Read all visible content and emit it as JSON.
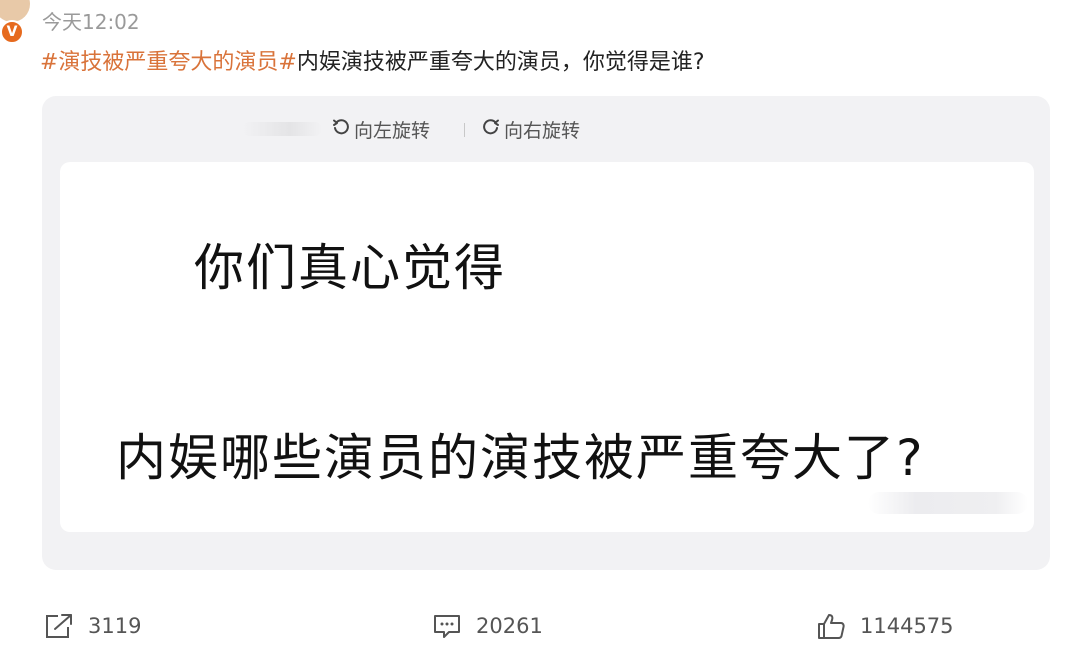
{
  "post": {
    "timestamp": "今天12:02",
    "hashtag": "#演技被严重夸大的演员#",
    "text": "内娱演技被严重夸大的演员，你觉得是谁?"
  },
  "image_viewer": {
    "rotate_left_label": "向左旋转",
    "rotate_right_label": "向右旋转",
    "image_text_line1": "你们真心觉得",
    "image_text_line2": "内娱哪些演员的演技被严重夸大了?"
  },
  "actions": {
    "share_count": "3119",
    "comment_count": "20261",
    "like_count": "1144575"
  },
  "colors": {
    "hashtag": "#d9733a",
    "verified_badge": "#e66a1e"
  },
  "icons": {
    "verified": "verified-v-badge-icon",
    "rotate_left": "rotate-counterclockwise-icon",
    "rotate_right": "rotate-clockwise-icon",
    "share": "share-icon",
    "comment": "comment-icon",
    "like": "thumbs-up-icon"
  }
}
